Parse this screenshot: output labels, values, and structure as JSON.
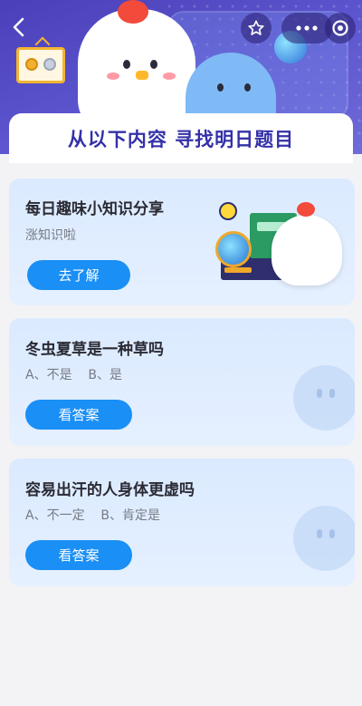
{
  "header": {
    "title": "从以下内容 寻找明日题目",
    "icons": [
      "back-icon",
      "star-icon",
      "more-icon",
      "target-icon"
    ]
  },
  "cards": [
    {
      "title": "每日趣味小知识分享",
      "subtitle": "涨知识啦",
      "button": "去了解"
    },
    {
      "title": "冬虫夏草是一种草吗",
      "options": "A、不是    B、是",
      "button": "看答案"
    },
    {
      "title": "容易出汗的人身体更虚吗",
      "options": "A、不一定    B、肯定是",
      "button": "看答案"
    }
  ],
  "colors": {
    "accent": "#1a8ff5",
    "title": "#3431a8",
    "banner": "#4a3fb8",
    "card_bg": "#dbeaff"
  }
}
